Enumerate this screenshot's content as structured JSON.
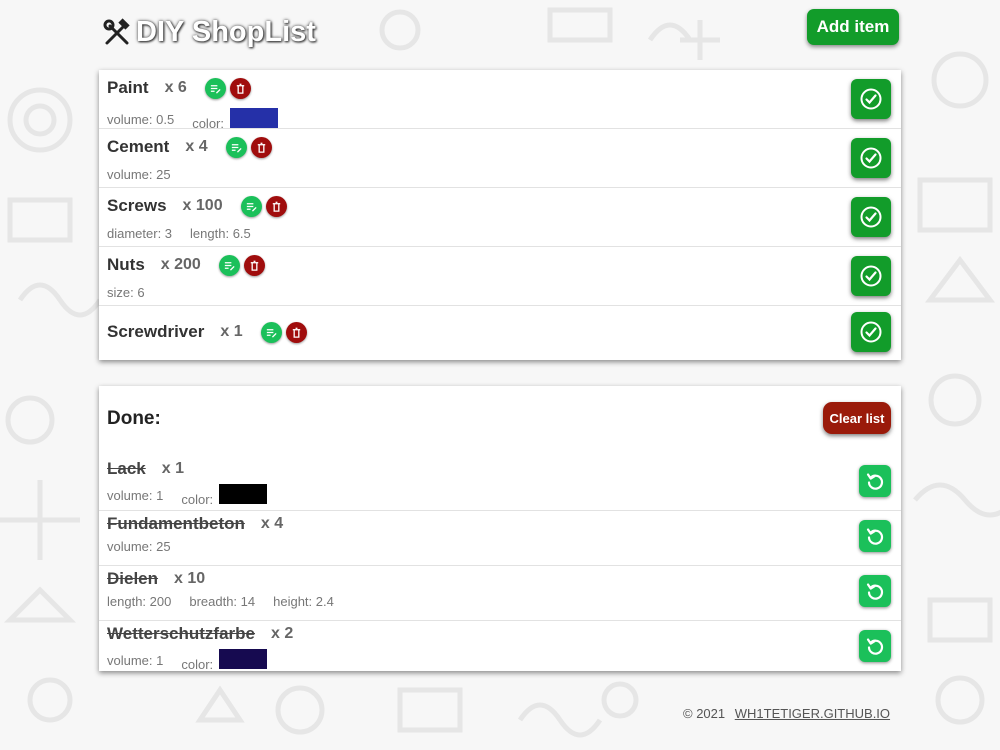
{
  "header": {
    "title": "DIY ShopList",
    "add_label": "Add item"
  },
  "todo": [
    {
      "name": "Paint",
      "qty": "x 6",
      "props": [
        {
          "label": "volume: 0.5"
        },
        {
          "label": "color:",
          "swatch": "#2530a8"
        }
      ]
    },
    {
      "name": "Cement",
      "qty": "x 4",
      "props": [
        {
          "label": "volume: 25"
        }
      ]
    },
    {
      "name": "Screws",
      "qty": "x 100",
      "props": [
        {
          "label": "diameter: 3"
        },
        {
          "label": "length: 6.5"
        }
      ]
    },
    {
      "name": "Nuts",
      "qty": "x 200",
      "props": [
        {
          "label": "size: 6"
        }
      ]
    },
    {
      "name": "Screwdriver",
      "qty": "x 1",
      "props": []
    }
  ],
  "done": {
    "title": "Done:",
    "clear_label": "Clear list",
    "items": [
      {
        "name": "Lack",
        "qty": "x 1",
        "props": [
          {
            "label": "volume: 1"
          },
          {
            "label": "color:",
            "swatch": "#000000"
          }
        ]
      },
      {
        "name": "Fundamentbeton",
        "qty": "x 4",
        "props": [
          {
            "label": "volume: 25"
          }
        ]
      },
      {
        "name": "Dielen",
        "qty": "x 10",
        "props": [
          {
            "label": "length: 200"
          },
          {
            "label": "breadth: 14"
          },
          {
            "label": "height: 2.4"
          }
        ]
      },
      {
        "name": "Wetterschutzfarbe",
        "qty": "x 2",
        "props": [
          {
            "label": "volume: 1"
          },
          {
            "label": "color:",
            "swatch": "#160a50"
          }
        ]
      }
    ]
  },
  "footer": {
    "copyright": "© 2021",
    "link": "WH1TETIGER.GITHUB.IO"
  },
  "colors": {
    "primary_green": "#129c2a",
    "light_green": "#1bc05a",
    "danger_red": "#a00d0d"
  },
  "icons": {
    "logo": "hammer-wrench-icon",
    "edit": "edit-icon",
    "delete": "trash-icon",
    "done": "check-circle-icon",
    "undo": "undo-icon"
  }
}
